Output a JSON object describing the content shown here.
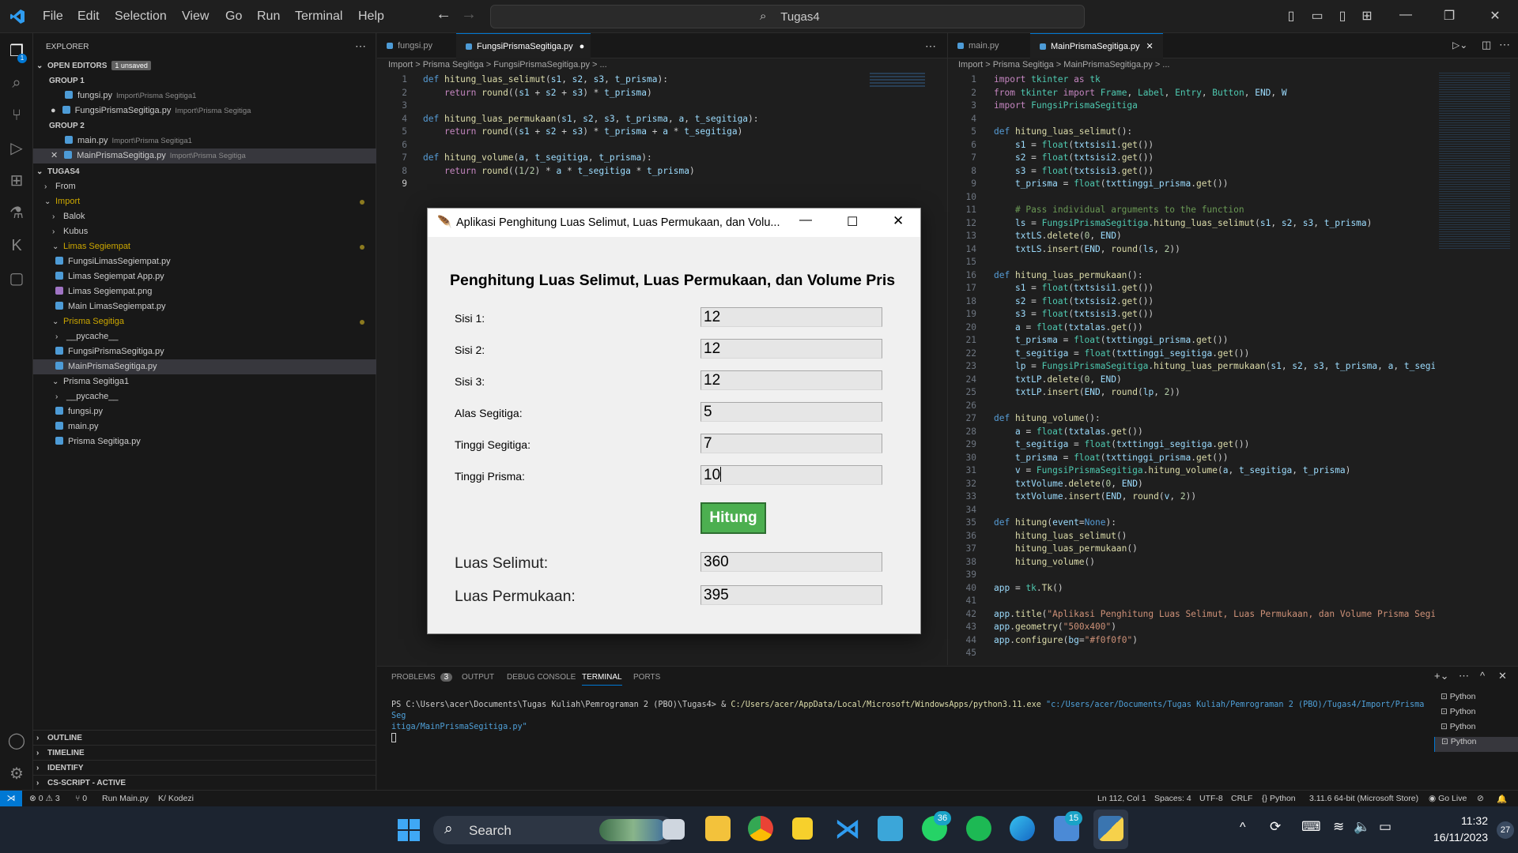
{
  "titlebar": {
    "menu": [
      "File",
      "Edit",
      "Selection",
      "View",
      "Go",
      "Run",
      "Terminal",
      "Help"
    ],
    "search": "Tugas4"
  },
  "sidebar": {
    "header": "EXPLORER",
    "open_editors": "OPEN EDITORS",
    "unsaved": "1 unsaved",
    "group1": "GROUP 1",
    "group2": "GROUP 2",
    "oe1": {
      "name": "fungsi.py",
      "path": "Import\\Prisma Segitiga1"
    },
    "oe2": {
      "name": "FungsiPrismaSegitiga.py",
      "path": "Import\\Prisma Segitiga"
    },
    "oe3": {
      "name": "main.py",
      "path": "Import\\Prisma Segitiga1"
    },
    "oe4": {
      "name": "MainPrismaSegitiga.py",
      "path": "Import\\Prisma Segitiga"
    },
    "project": "TUGAS4",
    "tree": [
      "From",
      "Import",
      "Balok",
      "Kubus",
      "Limas Segiempat",
      "FungsiLimasSegiempat.py",
      "Limas Segiempat App.py",
      "Limas Segiempat.png",
      "Main LimasSegiempat.py",
      "Prisma Segitiga",
      "__pycache__",
      "FungsiPrismaSegitiga.py",
      "MainPrismaSegitiga.py",
      "Prisma Segitiga1",
      "__pycache__",
      "fungsi.py",
      "main.py",
      "Prisma Segitiga.py"
    ],
    "sections": [
      "OUTLINE",
      "TIMELINE",
      "IDENTIFY",
      "CS-SCRIPT - ACTIVE"
    ]
  },
  "editor_left": {
    "tabs": [
      "fungsi.py",
      "FungsiPrismaSegitiga.py"
    ],
    "breadcrumb": "Import  >  Prisma Segitiga  >  FungsiPrismaSegitiga.py  >  ..."
  },
  "editor_right": {
    "tabs": [
      "main.py",
      "MainPrismaSegitiga.py"
    ],
    "breadcrumb": "Import  >  Prisma Segitiga  >  MainPrismaSegitiga.py  >  ..."
  },
  "tk": {
    "title": "Aplikasi Penghitung Luas Selimut, Luas Permukaan, dan Volu...",
    "heading": "Penghitung Luas Selimut, Luas Permukaan, dan Volume Pris",
    "labels": [
      "Sisi 1:",
      "Sisi 2:",
      "Sisi 3:",
      "Alas Segitiga:",
      "Tinggi Segitiga:",
      "Tinggi Prisma:"
    ],
    "values": [
      "12",
      "12",
      "12",
      "5",
      "7",
      "10"
    ],
    "button": "Hitung",
    "out_labels": [
      "Luas Selimut:",
      "Luas Permukaan:"
    ],
    "out_values": [
      "360",
      "395"
    ]
  },
  "panel": {
    "tabs": [
      "PROBLEMS",
      "OUTPUT",
      "DEBUG CONSOLE",
      "TERMINAL",
      "PORTS"
    ],
    "problems_count": "3",
    "prompt": "PS C:\\Users\\acer\\Documents\\Tugas Kuliah\\Pemrograman 2 (PBO)\\Tugas4> & ",
    "exe": "C:/Users/acer/AppData/Local/Microsoft/WindowsApps/python3.11.exe",
    "arg1": "\"c:/Users/acer/Documents/Tugas Kuliah/Pemrograman 2 (PBO)/Tugas4/Import/Prisma Seg",
    "arg2": "itiga/MainPrismaSegitiga.py\"",
    "terminals": [
      "Python",
      "Python",
      "Python",
      "Python"
    ]
  },
  "status": {
    "errors": "0",
    "warnings": "3",
    "ports": "0",
    "run": "Run Main.py",
    "kodezi": "Kodezi",
    "pos": "Ln 112, Col 1",
    "spaces": "Spaces: 4",
    "enc": "UTF-8",
    "eol": "CRLF",
    "lang": "Python",
    "interp": "3.11.6 64-bit (Microsoft Store)",
    "golive": "Go Live"
  },
  "taskbar": {
    "search": "Search",
    "time": "11:32",
    "date": "16/11/2023",
    "badge_wa": "36",
    "badge_mail": "15",
    "badge_cal": "27"
  }
}
